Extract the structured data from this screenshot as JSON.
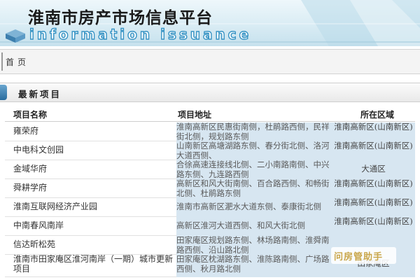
{
  "header": {
    "title": "淮南市房产市场信息平台",
    "subtitle": "information issuance"
  },
  "breadcrumb": {
    "home": "首页"
  },
  "section": {
    "title": "最新项目"
  },
  "table": {
    "columns": [
      "项目名称",
      "项目地址",
      "所在区域"
    ],
    "rows": [
      {
        "name": "雍荣府",
        "address": "淮南高新区民惠街南侧，杜鹃路西侧，民祥街北侧，规划路东侧",
        "region": "淮南高新区(山南新区)"
      },
      {
        "name": "中电科文创园",
        "address": "山南新区高塘湖路东侧、春分街北侧、洛河大道西侧、",
        "region": "淮南高新区(山南新区)"
      },
      {
        "name": "金域华府",
        "address": "合徐高速连接线北侧、二小南路南侧、中兴路东侧、九连路西侧",
        "region": "大通区"
      },
      {
        "name": "舜耕学府",
        "address": "高新区和风大街南侧、百合路西侧、和畅街北侧、杜鹃路东侧",
        "region": "淮南高新区(山南新区)"
      },
      {
        "name": "淮南互联网经济产业园",
        "address": "淮南市高新区淝水大道东侧、泰康街北侧",
        "region": "淮南高新区(山南新区)"
      },
      {
        "name": "中南春风南岸",
        "address": "高新区淮河大道西侧、和风大街北侧",
        "region": "淮南高新区(山南新区)"
      },
      {
        "name": "信达昕松苑",
        "address": "田家庵区规划路东侧、林场路南侧、淮舜南路西侧、沿山路北侧",
        "region": ""
      },
      {
        "name": "淮南市田家庵区淮河南岸（一期）城市更新项目",
        "address": "田家庵区枕湖路东侧、淮陈路南侧、广场路西侧、秋月路北侧",
        "region": "田家庵区"
      }
    ]
  },
  "watermark": {
    "text": "问房管助手"
  },
  "colors": {
    "cell_highlight": "#d7e6f1",
    "banner": "#c6e1ed",
    "section_tab": "#2a6c9e"
  }
}
